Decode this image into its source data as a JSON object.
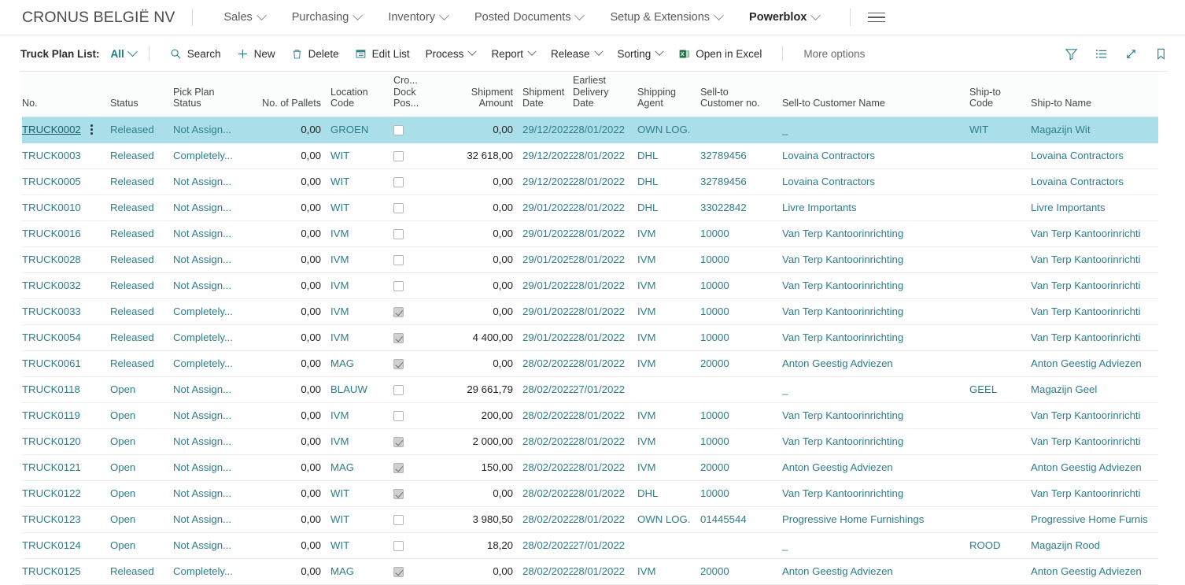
{
  "topnav": {
    "company": "CRONUS BELGIË NV",
    "menus": [
      {
        "label": "Sales",
        "bold": false
      },
      {
        "label": "Purchasing",
        "bold": false
      },
      {
        "label": "Inventory",
        "bold": false
      },
      {
        "label": "Posted Documents",
        "bold": false
      },
      {
        "label": "Setup & Extensions",
        "bold": false
      },
      {
        "label": "Powerblox",
        "bold": true
      }
    ],
    "menu_icon": "hamburger-icon"
  },
  "commandbar": {
    "page_label": "Truck Plan List:",
    "filter_value": "All",
    "actions": [
      {
        "label": "Search",
        "icon": "search-icon",
        "caret": false
      },
      {
        "label": "New",
        "icon": "plus-icon",
        "caret": false
      },
      {
        "label": "Delete",
        "icon": "trash-icon",
        "caret": false
      },
      {
        "label": "Edit List",
        "icon": "edit-list-icon",
        "caret": false
      },
      {
        "label": "Process",
        "icon": "",
        "caret": true
      },
      {
        "label": "Report",
        "icon": "",
        "caret": true
      },
      {
        "label": "Release",
        "icon": "",
        "caret": true
      },
      {
        "label": "Sorting",
        "icon": "",
        "caret": true
      },
      {
        "label": "Open in Excel",
        "icon": "excel-icon",
        "caret": false
      }
    ],
    "more_options": "More options",
    "right_icons": [
      "filter-icon",
      "list-icon",
      "expand-icon",
      "bookmark-icon"
    ]
  },
  "table": {
    "columns": [
      {
        "key": "no",
        "header": "No.",
        "align": "left"
      },
      {
        "key": "status",
        "header": "Status",
        "align": "left"
      },
      {
        "key": "pick",
        "header": "Pick Plan\nStatus",
        "align": "left"
      },
      {
        "key": "pallets",
        "header": "No. of Pallets",
        "align": "right"
      },
      {
        "key": "location",
        "header": "Location Code",
        "align": "left"
      },
      {
        "key": "crossdock",
        "header": "Cro...\nDock\nPos...",
        "align": "left"
      },
      {
        "key": "shipamt",
        "header": "Shipment\nAmount",
        "align": "right"
      },
      {
        "key": "shipdate",
        "header": "Shipment\nDate",
        "align": "left"
      },
      {
        "key": "earliest",
        "header": "Earliest\nDelivery\nDate",
        "align": "left"
      },
      {
        "key": "agent",
        "header": "Shipping\nAgent",
        "align": "left"
      },
      {
        "key": "sellno",
        "header": "Sell-to\nCustomer no.",
        "align": "left"
      },
      {
        "key": "sellname",
        "header": "Sell-to Customer Name",
        "align": "left"
      },
      {
        "key": "shipcode",
        "header": "Ship-to\nCode",
        "align": "left"
      },
      {
        "key": "shipname",
        "header": "Ship-to Name",
        "align": "left"
      }
    ],
    "rows": [
      {
        "no": "TRUCK0002",
        "status": "Released",
        "pick": "Not Assign...",
        "pallets": "0,00",
        "location": "GROEN",
        "crossdock": false,
        "shipamt": "0,00",
        "shipdate": "29/12/2022",
        "earliest": "28/01/2022",
        "agent": "OWN LOG.",
        "sellno": "",
        "sellname": "_",
        "shipcode": "WIT",
        "shipname": "Magazijn Wit",
        "selected": true
      },
      {
        "no": "TRUCK0003",
        "status": "Released",
        "pick": "Completely...",
        "pallets": "0,00",
        "location": "WIT",
        "crossdock": false,
        "shipamt": "32 618,00",
        "shipdate": "29/12/2022",
        "earliest": "28/01/2022",
        "agent": "DHL",
        "sellno": "32789456",
        "sellname": "Lovaina Contractors",
        "shipcode": "",
        "shipname": "Lovaina Contractors",
        "selected": false
      },
      {
        "no": "TRUCK0005",
        "status": "Released",
        "pick": "Not Assign...",
        "pallets": "0,00",
        "location": "WIT",
        "crossdock": false,
        "shipamt": "0,00",
        "shipdate": "29/12/2022",
        "earliest": "28/01/2022",
        "agent": "DHL",
        "sellno": "32789456",
        "sellname": "Lovaina Contractors",
        "shipcode": "",
        "shipname": "Lovaina Contractors",
        "selected": false
      },
      {
        "no": "TRUCK0010",
        "status": "Released",
        "pick": "Not Assign...",
        "pallets": "0,00",
        "location": "WIT",
        "crossdock": false,
        "shipamt": "0,00",
        "shipdate": "29/01/2022",
        "earliest": "28/01/2022",
        "agent": "DHL",
        "sellno": "33022842",
        "sellname": "Livre Importants",
        "shipcode": "",
        "shipname": "Livre Importants",
        "selected": false
      },
      {
        "no": "TRUCK0016",
        "status": "Released",
        "pick": "Not Assign...",
        "pallets": "0,00",
        "location": "IVM",
        "crossdock": false,
        "shipamt": "0,00",
        "shipdate": "29/01/2022",
        "earliest": "28/01/2022",
        "agent": "IVM",
        "sellno": "10000",
        "sellname": "Van Terp Kantoorinrichting",
        "shipcode": "",
        "shipname": "Van Terp Kantoorinrichti",
        "selected": false
      },
      {
        "no": "TRUCK0028",
        "status": "Released",
        "pick": "Not Assign...",
        "pallets": "0,00",
        "location": "IVM",
        "crossdock": false,
        "shipamt": "0,00",
        "shipdate": "29/01/2025",
        "earliest": "28/01/2022",
        "agent": "IVM",
        "sellno": "10000",
        "sellname": "Van Terp Kantoorinrichting",
        "shipcode": "",
        "shipname": "Van Terp Kantoorinrichti",
        "selected": false
      },
      {
        "no": "TRUCK0032",
        "status": "Released",
        "pick": "Not Assign...",
        "pallets": "0,00",
        "location": "IVM",
        "crossdock": false,
        "shipamt": "0,00",
        "shipdate": "29/01/2022",
        "earliest": "28/01/2022",
        "agent": "IVM",
        "sellno": "10000",
        "sellname": "Van Terp Kantoorinrichting",
        "shipcode": "",
        "shipname": "Van Terp Kantoorinrichti",
        "selected": false
      },
      {
        "no": "TRUCK0033",
        "status": "Released",
        "pick": "Completely...",
        "pallets": "0,00",
        "location": "IVM",
        "crossdock": true,
        "shipamt": "0,00",
        "shipdate": "29/01/2022",
        "earliest": "28/01/2022",
        "agent": "IVM",
        "sellno": "10000",
        "sellname": "Van Terp Kantoorinrichting",
        "shipcode": "",
        "shipname": "Van Terp Kantoorinrichti",
        "selected": false
      },
      {
        "no": "TRUCK0054",
        "status": "Released",
        "pick": "Completely...",
        "pallets": "0,00",
        "location": "IVM",
        "crossdock": true,
        "shipamt": "4 400,00",
        "shipdate": "29/01/2022",
        "earliest": "28/01/2022",
        "agent": "IVM",
        "sellno": "10000",
        "sellname": "Van Terp Kantoorinrichting",
        "shipcode": "",
        "shipname": "Van Terp Kantoorinrichti",
        "selected": false
      },
      {
        "no": "TRUCK0061",
        "status": "Released",
        "pick": "Completely...",
        "pallets": "0,00",
        "location": "MAG",
        "crossdock": true,
        "shipamt": "0,00",
        "shipdate": "28/02/2022",
        "earliest": "28/01/2022",
        "agent": "IVM",
        "sellno": "20000",
        "sellname": "Anton Geestig Adviezen",
        "shipcode": "",
        "shipname": "Anton Geestig Adviezen",
        "selected": false
      },
      {
        "no": "TRUCK0118",
        "status": "Open",
        "pick": "Not Assign...",
        "pallets": "0,00",
        "location": "BLAUW",
        "crossdock": false,
        "shipamt": "29 661,79",
        "shipdate": "28/02/2022",
        "earliest": "27/01/2022",
        "agent": "",
        "sellno": "",
        "sellname": "_",
        "shipcode": "GEEL",
        "shipname": "Magazijn Geel",
        "selected": false
      },
      {
        "no": "TRUCK0119",
        "status": "Open",
        "pick": "Not Assign...",
        "pallets": "0,00",
        "location": "IVM",
        "crossdock": false,
        "shipamt": "200,00",
        "shipdate": "28/02/2022",
        "earliest": "28/01/2022",
        "agent": "IVM",
        "sellno": "10000",
        "sellname": "Van Terp Kantoorinrichting",
        "shipcode": "",
        "shipname": "Van Terp Kantoorinrichti",
        "selected": false
      },
      {
        "no": "TRUCK0120",
        "status": "Open",
        "pick": "Not Assign...",
        "pallets": "0,00",
        "location": "IVM",
        "crossdock": true,
        "shipamt": "2 000,00",
        "shipdate": "28/02/2022",
        "earliest": "28/01/2022",
        "agent": "IVM",
        "sellno": "10000",
        "sellname": "Van Terp Kantoorinrichting",
        "shipcode": "",
        "shipname": "Van Terp Kantoorinrichti",
        "selected": false
      },
      {
        "no": "TRUCK0121",
        "status": "Open",
        "pick": "Not Assign...",
        "pallets": "0,00",
        "location": "MAG",
        "crossdock": true,
        "shipamt": "150,00",
        "shipdate": "28/02/2022",
        "earliest": "28/01/2022",
        "agent": "IVM",
        "sellno": "20000",
        "sellname": "Anton Geestig Adviezen",
        "shipcode": "",
        "shipname": "Anton Geestig Adviezen",
        "selected": false
      },
      {
        "no": "TRUCK0122",
        "status": "Open",
        "pick": "Not Assign...",
        "pallets": "0,00",
        "location": "WIT",
        "crossdock": true,
        "shipamt": "0,00",
        "shipdate": "28/02/2022",
        "earliest": "28/01/2022",
        "agent": "DHL",
        "sellno": "10000",
        "sellname": "Van Terp Kantoorinrichting",
        "shipcode": "",
        "shipname": "Van Terp Kantoorinrichti",
        "selected": false
      },
      {
        "no": "TRUCK0123",
        "status": "Open",
        "pick": "Not Assign...",
        "pallets": "0,00",
        "location": "WIT",
        "crossdock": false,
        "shipamt": "3 980,50",
        "shipdate": "28/02/2022",
        "earliest": "28/01/2022",
        "agent": "OWN LOG.",
        "sellno": "01445544",
        "sellname": "Progressive Home Furnishings",
        "shipcode": "",
        "shipname": "Progressive Home Furnis",
        "selected": false
      },
      {
        "no": "TRUCK0124",
        "status": "Open",
        "pick": "Not Assign...",
        "pallets": "0,00",
        "location": "WIT",
        "crossdock": false,
        "shipamt": "18,20",
        "shipdate": "28/02/2022",
        "earliest": "27/01/2022",
        "agent": "",
        "sellno": "",
        "sellname": "_",
        "shipcode": "ROOD",
        "shipname": "Magazijn Rood",
        "selected": false
      },
      {
        "no": "TRUCK0125",
        "status": "Released",
        "pick": "Completely...",
        "pallets": "0,00",
        "location": "MAG",
        "crossdock": true,
        "shipamt": "0,00",
        "shipdate": "28/02/2022",
        "earliest": "28/01/2022",
        "agent": "IVM",
        "sellno": "20000",
        "sellname": "Anton Geestig Adviezen",
        "shipcode": "",
        "shipname": "Anton Geestig Adviezen",
        "selected": false
      }
    ]
  },
  "colors": {
    "link": "#2e7d8a",
    "accent": "#1b7b88",
    "selected_row": "#aadfe9",
    "header_rule": "#cfe9ee"
  }
}
